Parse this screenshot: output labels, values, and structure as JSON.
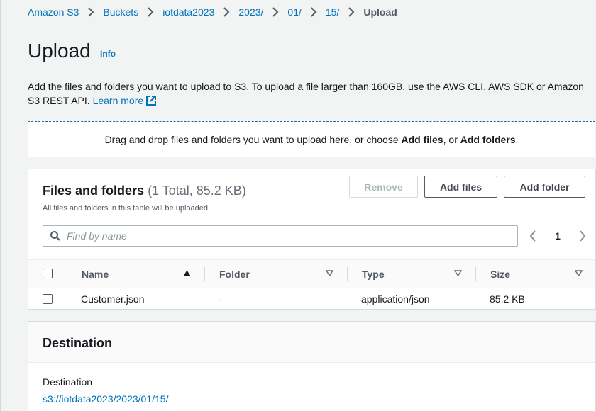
{
  "colors": {
    "link": "#0073bb",
    "text": "#16191f",
    "muted": "#545b64",
    "dropzone_border": "#0f7387",
    "background": "#f2f3f3"
  },
  "breadcrumb": {
    "items": [
      "Amazon S3",
      "Buckets",
      "iotdata2023",
      "2023/",
      "01/",
      "15/"
    ],
    "current": "Upload",
    "separator_icon": "chevron-right-icon"
  },
  "header": {
    "title": "Upload",
    "info_link": "Info"
  },
  "description": {
    "text": "Add the files and folders you want to upload to S3. To upload a file larger than 160GB, use the AWS CLI, AWS SDK or Amazon S3 REST API.",
    "learn_more": "Learn more",
    "learn_more_icon": "external-link-icon"
  },
  "dropzone": {
    "prefix": "Drag and drop files and folders you want to upload here, or choose ",
    "add_files": "Add files",
    "middle": ", or ",
    "add_folders": "Add folders",
    "suffix": "."
  },
  "files_panel": {
    "title": "Files and folders",
    "count": "(1 Total, 85.2 KB)",
    "subtitle": "All files and folders in this table will be uploaded.",
    "buttons": {
      "remove": "Remove",
      "add_files": "Add files",
      "add_folder": "Add folder"
    },
    "search": {
      "placeholder": "Find by name",
      "value": ""
    },
    "pagination": {
      "current_page": "1"
    },
    "columns": [
      {
        "label": "Name",
        "sort": "ascending"
      },
      {
        "label": "Folder",
        "sort": "none"
      },
      {
        "label": "Type",
        "sort": "none"
      },
      {
        "label": "Size",
        "sort": "none"
      }
    ],
    "rows": [
      {
        "name": "Customer.json",
        "folder": "-",
        "type": "application/json",
        "size": "85.2 KB",
        "selected": false
      }
    ]
  },
  "destination_panel": {
    "title": "Destination",
    "label": "Destination",
    "value": "s3://iotdata2023/2023/01/15/"
  }
}
